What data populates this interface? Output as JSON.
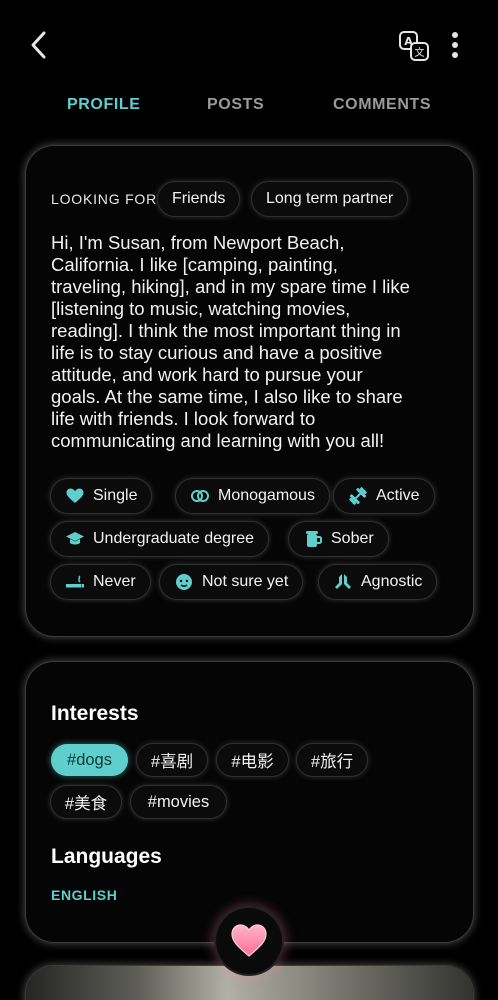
{
  "header": {
    "back_icon": "chevron-left-icon",
    "translate_icon": "translate-icon",
    "more_icon": "more-vertical-icon"
  },
  "tabs": [
    {
      "label": "PROFILE",
      "active": true
    },
    {
      "label": "POSTS",
      "active": false
    },
    {
      "label": "COMMENTS",
      "active": false
    }
  ],
  "profile": {
    "looking_for_label": "LOOKING FOR",
    "looking_for": [
      "Friends",
      "Long term partner"
    ],
    "bio_lines": [
      "Hi, I'm Susan, from Newport Beach,",
      "California. I like [camping, painting,",
      "traveling, hiking], and in my spare time I like",
      "[listening to music, watching movies,",
      "reading]. I think the most important thing in",
      "life is to stay curious and have a positive",
      "attitude, and work hard to pursue your",
      "goals. At the same time, I also like to share",
      "life with friends. I look forward to",
      "communicating and learning with you all!"
    ],
    "attributes": [
      {
        "label": "Single",
        "icon": "heart-icon"
      },
      {
        "label": "Monogamous",
        "icon": "rings-icon"
      },
      {
        "label": "Active",
        "icon": "dumbbell-icon"
      },
      {
        "label": "Undergraduate degree",
        "icon": "graduation-cap-icon"
      },
      {
        "label": "Sober",
        "icon": "beer-mug-icon"
      },
      {
        "label": "Never",
        "icon": "cigarette-icon"
      },
      {
        "label": "Not sure yet",
        "icon": "baby-icon"
      },
      {
        "label": "Agnostic",
        "icon": "praying-hands-icon"
      }
    ]
  },
  "interests": {
    "title": "Interests",
    "tags": [
      {
        "label": "#dogs",
        "active": true
      },
      {
        "label": "#喜剧",
        "active": false
      },
      {
        "label": "#电影",
        "active": false
      },
      {
        "label": "#旅行",
        "active": false
      },
      {
        "label": "#美食",
        "active": false
      },
      {
        "label": "#movies",
        "active": false
      }
    ]
  },
  "languages": {
    "title": "Languages",
    "items": [
      "ENGLISH"
    ]
  },
  "like_button_icon": "heart-icon",
  "colors": {
    "accent": "#5fcfce",
    "background": "#000000",
    "like": "#ff8fb3"
  }
}
